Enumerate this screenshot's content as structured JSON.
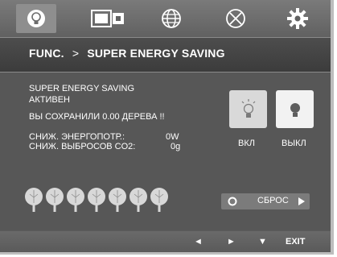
{
  "tabs": [
    {
      "icon": "lightbulb-icon",
      "active": true
    },
    {
      "icon": "picture-icon",
      "active": false
    },
    {
      "icon": "globe-icon",
      "active": false
    },
    {
      "icon": "circle-x-icon",
      "active": false
    },
    {
      "icon": "gear-icon",
      "active": false
    }
  ],
  "header": {
    "section": "FUNC.",
    "separator": ">",
    "title": "SUPER ENERGY SAVING"
  },
  "status": {
    "line1": "SUPER ENERGY SAVING",
    "line2": "АКТИВЕН",
    "line3": "ВЫ СОХРАНИЛИ 0.00 ДЕРЕВА !!",
    "reduction_label": "СНИЖ. ЭНЕРГОПОТР.:",
    "reduction_value": "0W",
    "co2_label": "СНИЖ. ВЫБРОСОВ CO2:",
    "co2_value": "0g"
  },
  "toggles": {
    "on_label": "ВКЛ",
    "off_label": "ВЫКЛ",
    "selected": "on"
  },
  "trees_count": 7,
  "reset": {
    "label": "СБРОС"
  },
  "footer": {
    "left": "◄",
    "right": "►",
    "down": "▼",
    "exit": "EXIT"
  },
  "colors": {
    "background": "#575757",
    "header": "#3c3c3c",
    "accent": "#ffffff"
  }
}
